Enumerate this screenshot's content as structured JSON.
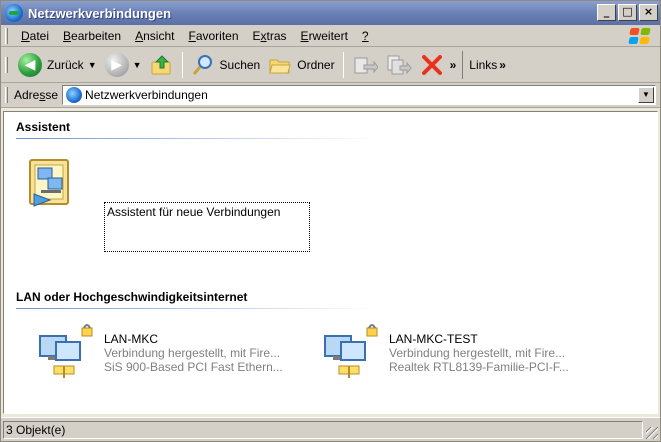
{
  "window": {
    "title": "Netzwerkverbindungen"
  },
  "caption_buttons": {
    "minimize": "_",
    "maximize": "□",
    "close": "×"
  },
  "menubar": {
    "items": [
      {
        "pre": "",
        "u": "D",
        "post": "atei"
      },
      {
        "pre": "",
        "u": "B",
        "post": "earbeiten"
      },
      {
        "pre": "",
        "u": "A",
        "post": "nsicht"
      },
      {
        "pre": "",
        "u": "F",
        "post": "avoriten"
      },
      {
        "pre": "E",
        "u": "x",
        "post": "tras"
      },
      {
        "pre": "",
        "u": "E",
        "post": "rweitert"
      },
      {
        "pre": "",
        "u": "?",
        "post": ""
      }
    ]
  },
  "toolbar": {
    "back_label": "Zurück",
    "search_label": "Suchen",
    "folders_label": "Ordner",
    "chevron": "»",
    "links_label": "Links"
  },
  "address": {
    "label_pre": "Adre",
    "label_u": "s",
    "label_post": "se",
    "value": "Netzwerkverbindungen"
  },
  "groups": {
    "wizard": {
      "header": "Assistent",
      "item_label": "Assistent für neue Verbindungen"
    },
    "lan": {
      "header": "LAN oder Hochgeschwindigkeitsinternet",
      "connections": [
        {
          "name": "LAN-MKC",
          "status": "Verbindung hergestellt, mit Fire...",
          "device": "SiS 900-Based PCI Fast Ethern..."
        },
        {
          "name": "LAN-MKC-TEST",
          "status": "Verbindung hergestellt, mit Fire...",
          "device": "Realtek RTL8139-Familie-PCI-F..."
        }
      ]
    }
  },
  "statusbar": {
    "text": "3 Objekt(e)"
  },
  "colors": {
    "titlebar": "#6e84b8",
    "group_line": "#6b8fd6",
    "muted_text": "#808080"
  }
}
